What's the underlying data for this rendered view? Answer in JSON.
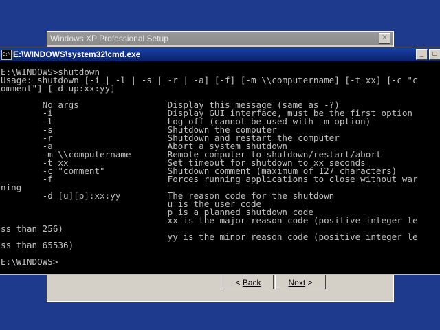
{
  "setup": {
    "title": "Windows XP Professional Setup",
    "back_label": "Back",
    "next_label": "Next"
  },
  "cmd": {
    "title": "E:\\WINDOWS\\system32\\cmd.exe",
    "lines": [
      "E:\\WINDOWS>shutdown",
      "Usage: shutdown [-i | -l | -s | -r | -a] [-f] [-m \\\\computername] [-t xx] [-c \"c",
      "omment\"] [-d up:xx:yy]",
      "",
      "        No args                 Display this message (same as -?)",
      "        -i                      Display GUI interface, must be the first option",
      "        -l                      Log off (cannot be used with -m option)",
      "        -s                      Shutdown the computer",
      "        -r                      Shutdown and restart the computer",
      "        -a                      Abort a system shutdown",
      "        -m \\\\computername       Remote computer to shutdown/restart/abort",
      "        -t xx                   Set timeout for shutdown to xx seconds",
      "        -c \"comment\"            Shutdown comment (maximum of 127 characters)",
      "        -f                      Forces running applications to close without war",
      "ning",
      "        -d [u][p]:xx:yy         The reason code for the shutdown",
      "                                u is the user code",
      "                                p is a planned shutdown code",
      "                                xx is the major reason code (positive integer le",
      "ss than 256)",
      "                                yy is the minor reason code (positive integer le",
      "ss than 65536)",
      "",
      "E:\\WINDOWS>"
    ]
  }
}
